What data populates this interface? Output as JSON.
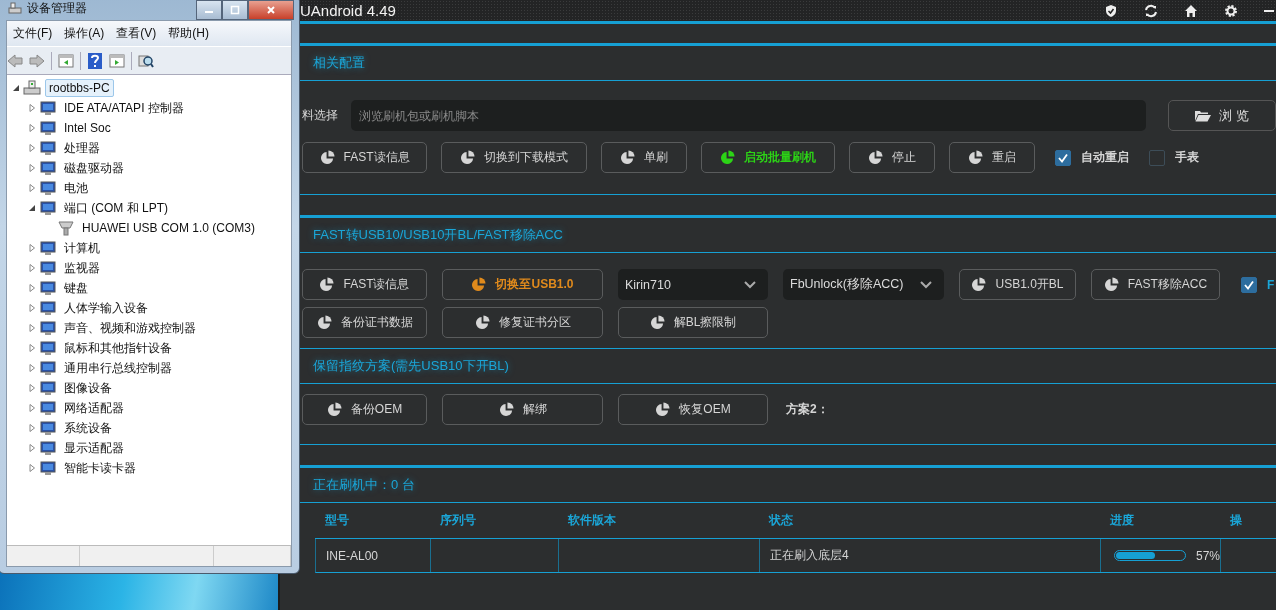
{
  "device_manager": {
    "title": "设备管理器",
    "menu": [
      "文件(F)",
      "操作(A)",
      "查看(V)",
      "帮助(H)"
    ],
    "tree": {
      "label": "rootbbs-PC",
      "expanded": true,
      "selected": true,
      "children": [
        {
          "label": "IDE ATA/ATAPI 控制器",
          "expanded": false
        },
        {
          "label": "Intel Soc",
          "expanded": false
        },
        {
          "label": "处理器",
          "expanded": false
        },
        {
          "label": "磁盘驱动器",
          "expanded": false
        },
        {
          "label": "电池",
          "expanded": false
        },
        {
          "label": "端口 (COM 和 LPT)",
          "expanded": true,
          "children": [
            {
              "label": "HUAWEI USB COM 1.0 (COM3)"
            }
          ]
        },
        {
          "label": "计算机",
          "expanded": false
        },
        {
          "label": "监视器",
          "expanded": false
        },
        {
          "label": "键盘",
          "expanded": false
        },
        {
          "label": "人体学输入设备",
          "expanded": false
        },
        {
          "label": "声音、视频和游戏控制器",
          "expanded": false
        },
        {
          "label": "鼠标和其他指针设备",
          "expanded": false
        },
        {
          "label": "通用串行总线控制器",
          "expanded": false
        },
        {
          "label": "图像设备",
          "expanded": false
        },
        {
          "label": "网络适配器",
          "expanded": false
        },
        {
          "label": "系统设备",
          "expanded": false
        },
        {
          "label": "显示适配器",
          "expanded": false
        },
        {
          "label": "智能卡读卡器",
          "expanded": false
        }
      ]
    }
  },
  "app": {
    "title": "UAndroid 4.49",
    "groups": [
      {
        "sections": [
          {
            "title": "相关配置",
            "file_label": "料选择",
            "file_field": {
              "placeholder": "浏览刷机包或刷机脚本"
            },
            "browse_button": "浏 览",
            "rows": [
              [
                {
                  "kind": "button",
                  "label": "FAST读信息",
                  "color": "#d6d6d6",
                  "bold": false
                },
                {
                  "kind": "button",
                  "label": "切换到下载模式",
                  "color": "#d6d6d6",
                  "bold": false
                },
                {
                  "kind": "button",
                  "label": "单刷",
                  "color": "#d6d6d6",
                  "bold": false
                },
                {
                  "kind": "button",
                  "label": "启动批量刷机",
                  "color": "#2cd416",
                  "bold": true
                },
                {
                  "kind": "button",
                  "label": "停止",
                  "color": "#d6d6d6",
                  "bold": false
                },
                {
                  "kind": "button",
                  "label": "重启",
                  "color": "#d6d6d6",
                  "bold": false
                },
                {
                  "kind": "checkbox",
                  "label": "自动重启",
                  "checked": true,
                  "color": "#d6d6d6"
                },
                {
                  "kind": "checkbox",
                  "label": "手表",
                  "checked": false,
                  "color": "#d6d6d6"
                }
              ]
            ]
          }
        ]
      },
      {
        "sections": [
          {
            "title": "FAST转USB10/USB10开BL/FAST移除ACC",
            "rows": [
              [
                {
                  "kind": "button",
                  "label": "FAST读信息",
                  "color": "#d6d6d6",
                  "bold": false
                },
                {
                  "kind": "button",
                  "label": "切换至USB1.0",
                  "color": "#e08a1c",
                  "bold": true
                },
                {
                  "kind": "select",
                  "label": "Kirin710"
                },
                {
                  "kind": "select",
                  "label": "FbUnlock(移除ACC)"
                },
                {
                  "kind": "button",
                  "label": "USB1.0开BL",
                  "color": "#d6d6d6",
                  "bold": false
                },
                {
                  "kind": "button",
                  "label": "FAST移除ACC",
                  "color": "#d6d6d6",
                  "bold": false
                },
                {
                  "kind": "checkbox",
                  "label": "F",
                  "checked": true,
                  "color": "#1aa6d8"
                }
              ],
              [
                {
                  "kind": "button",
                  "label": "备份证书数据",
                  "color": "#d6d6d6",
                  "bold": false
                },
                {
                  "kind": "button",
                  "label": "修复证书分区",
                  "color": "#d6d6d6",
                  "bold": false
                },
                {
                  "kind": "button",
                  "label": "解BL擦限制",
                  "color": "#d6d6d6",
                  "bold": false
                }
              ]
            ]
          },
          {
            "title": "保留指纹方案(需先USB10下开BL)",
            "rows": [
              [
                {
                  "kind": "button",
                  "label": "备份OEM",
                  "color": "#d6d6d6",
                  "bold": false
                },
                {
                  "kind": "button",
                  "label": "解绑",
                  "color": "#d6d6d6",
                  "bold": false
                },
                {
                  "kind": "button",
                  "label": "恢复OEM",
                  "color": "#d6d6d6",
                  "bold": false
                },
                {
                  "kind": "text",
                  "label": "方案2："
                }
              ]
            ]
          }
        ]
      }
    ],
    "flashing": {
      "title": "正在刷机中：0 台",
      "table": {
        "columns": [
          "型号",
          "序列号",
          "软件版本",
          "状态",
          "进度",
          "操"
        ],
        "rows": [
          {
            "model": "INE-AL00",
            "status": "正在刷入底层4",
            "level": 0.57,
            "progress": "57%"
          }
        ]
      }
    }
  }
}
